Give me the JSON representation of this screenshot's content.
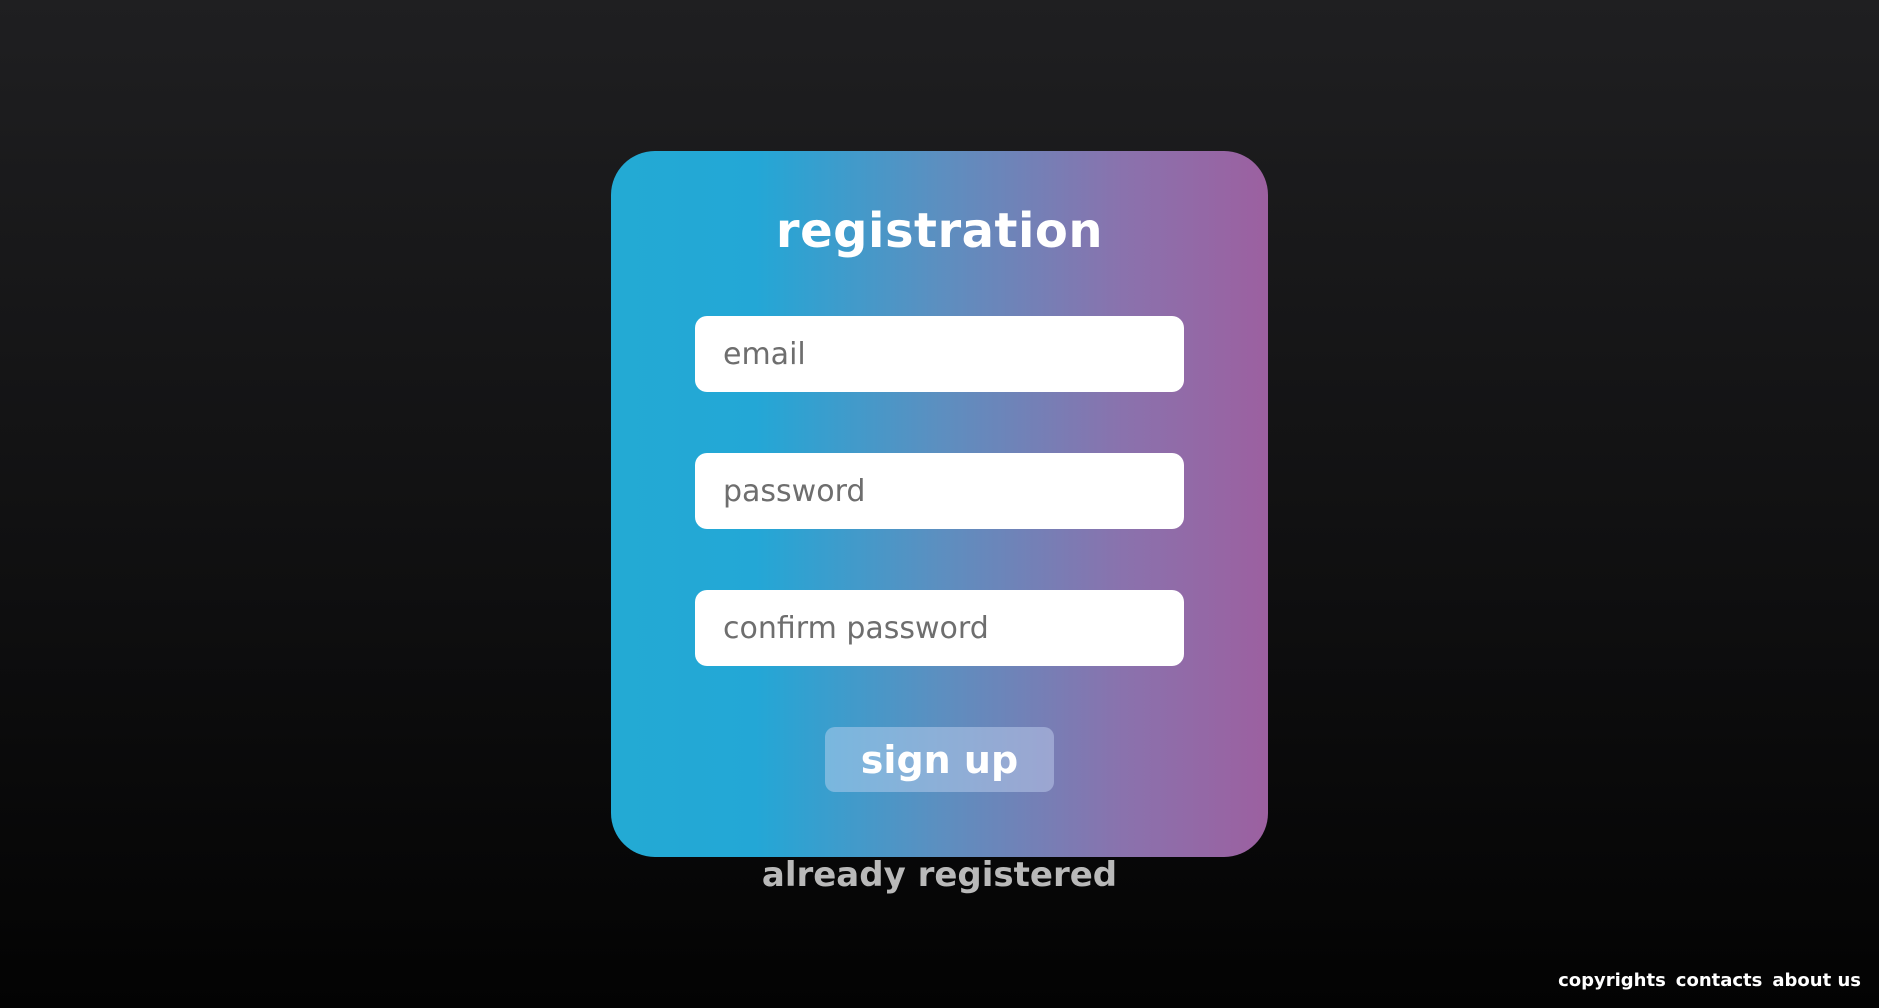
{
  "form": {
    "title": "registration",
    "email_placeholder": "email",
    "password_placeholder": "password",
    "confirm_placeholder": "confirm password",
    "submit_label": "sign up",
    "already_label": "already registered"
  },
  "footer": {
    "links": [
      "copyrights",
      "contacts",
      "about us"
    ]
  },
  "colors": {
    "card_gradient_start": "#23aad4",
    "card_gradient_end": "#9c60a0",
    "background_top": "#1f1f21",
    "background_bottom": "#030303"
  }
}
